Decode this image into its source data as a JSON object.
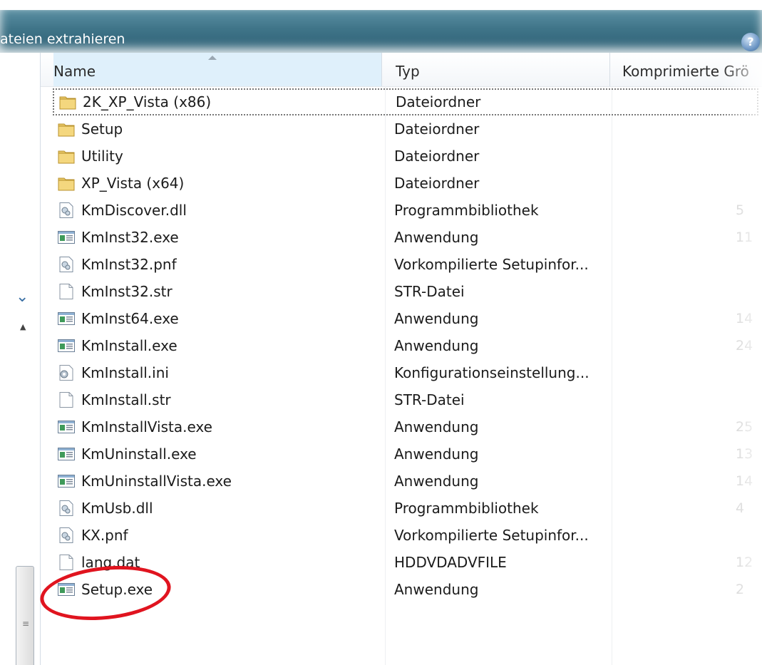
{
  "window": {
    "title": "ateien extrahieren",
    "help_glyph": "?"
  },
  "columns": {
    "name": "Name",
    "type": "Typ",
    "size": "Komprimierte Grö"
  },
  "left_nav": {
    "grip": "≡",
    "chevron": "⌄",
    "up": "▲"
  },
  "rows": [
    {
      "name": "2K_XP_Vista (x86)",
      "type": "Dateiordner",
      "size": "",
      "icon": "folder-icon",
      "focused": true
    },
    {
      "name": "Setup",
      "type": "Dateiordner",
      "size": "",
      "icon": "folder-icon"
    },
    {
      "name": "Utility",
      "type": "Dateiordner",
      "size": "",
      "icon": "folder-icon"
    },
    {
      "name": "XP_Vista (x64)",
      "type": "Dateiordner",
      "size": "",
      "icon": "folder-icon"
    },
    {
      "name": "KmDiscover.dll",
      "type": "Programmbibliothek",
      "size": "5",
      "icon": "dll-icon"
    },
    {
      "name": "KmInst32.exe",
      "type": "Anwendung",
      "size": "11",
      "icon": "exe-icon"
    },
    {
      "name": "KmInst32.pnf",
      "type": "Vorkompilierte Setupinfor...",
      "size": "",
      "icon": "dll-icon"
    },
    {
      "name": "KmInst32.str",
      "type": "STR-Datei",
      "size": "",
      "icon": "file-icon"
    },
    {
      "name": "KmInst64.exe",
      "type": "Anwendung",
      "size": "14",
      "icon": "exe-icon"
    },
    {
      "name": "KmInstall.exe",
      "type": "Anwendung",
      "size": "24",
      "icon": "exe-icon"
    },
    {
      "name": "KmInstall.ini",
      "type": "Konfigurationseinstellung...",
      "size": "",
      "icon": "ini-icon"
    },
    {
      "name": "KmInstall.str",
      "type": "STR-Datei",
      "size": "",
      "icon": "file-icon"
    },
    {
      "name": "KmInstallVista.exe",
      "type": "Anwendung",
      "size": "25",
      "icon": "exe-icon"
    },
    {
      "name": "KmUninstall.exe",
      "type": "Anwendung",
      "size": "13",
      "icon": "exe-icon"
    },
    {
      "name": "KmUninstallVista.exe",
      "type": "Anwendung",
      "size": "14",
      "icon": "exe-icon"
    },
    {
      "name": "KmUsb.dll",
      "type": "Programmbibliothek",
      "size": "4",
      "icon": "dll-icon"
    },
    {
      "name": "KX.pnf",
      "type": "Vorkompilierte Setupinfor...",
      "size": "",
      "icon": "dll-icon"
    },
    {
      "name": "lang.dat",
      "type": "HDDVDADVFILE",
      "size": "12",
      "icon": "file-icon"
    },
    {
      "name": "Setup.exe",
      "type": "Anwendung",
      "size": "2",
      "icon": "exe-icon",
      "highlighted": true
    }
  ],
  "colors": {
    "highlight_circle": "#e0141f",
    "titlebar": "#3f7488",
    "header_sorted": "#dff0fb"
  }
}
